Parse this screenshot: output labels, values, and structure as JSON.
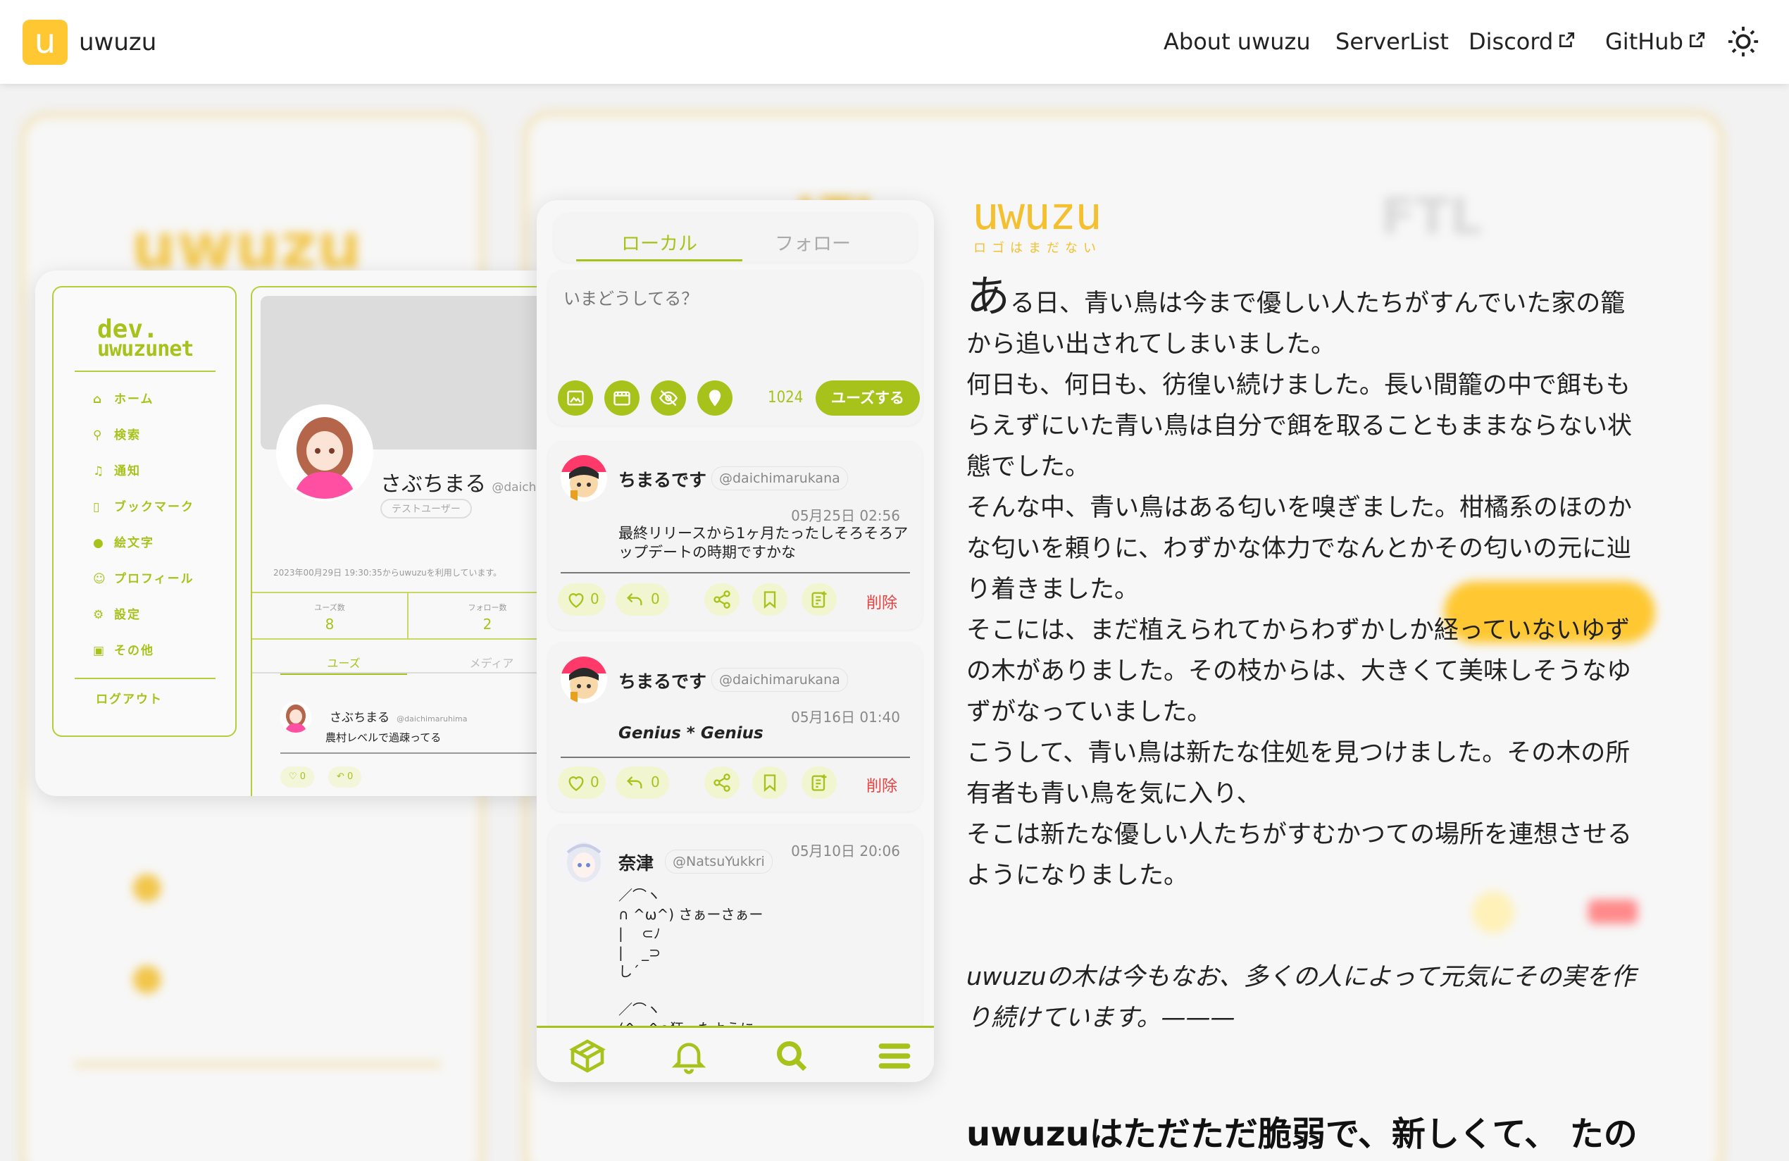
{
  "header": {
    "logo_letter": "u",
    "brand": "uwuzu",
    "nav": [
      "About uwuzu",
      "ServerList",
      "Discord",
      "GitHub"
    ],
    "theme_icon": "sun-icon"
  },
  "profile_mock": {
    "logo_line1": "dev.",
    "logo_line2": "uwuzunet",
    "menu": [
      {
        "icon": "home-icon",
        "label": "ホーム"
      },
      {
        "icon": "search-icon",
        "label": "検索"
      },
      {
        "icon": "bell-icon",
        "label": "通知"
      },
      {
        "icon": "bookmark-icon",
        "label": "ブックマーク"
      },
      {
        "icon": "pin-icon",
        "label": "絵文字"
      },
      {
        "icon": "profile-icon",
        "label": "プロフィール"
      },
      {
        "icon": "gear-icon",
        "label": "設定"
      },
      {
        "icon": "trash-icon",
        "label": "その他"
      }
    ],
    "logout": "ログアウト",
    "name": "さぶちまる",
    "handle": "@daichi",
    "badge": "テストユーザー",
    "joined": "2023年00月29日 19:30:35からuwuzuを利用しています。",
    "stats": [
      {
        "label": "ユーズ数",
        "value": "8"
      },
      {
        "label": "フォロー数",
        "value": "2"
      }
    ],
    "tabs": [
      "ユーズ",
      "メディア"
    ],
    "post": {
      "name": "さぶちまる",
      "handle": "@daichimaruhima",
      "text": "農村レベルで過疎ってる",
      "likes": "0",
      "reuse": "0"
    }
  },
  "timeline": {
    "tabs": [
      "ローカル",
      "フォロー"
    ],
    "active_tab": "ローカル",
    "compose": {
      "placeholder": "いまどうしてる？",
      "char_count": "1024",
      "submit": "ユーズする",
      "buttons": [
        "image-icon",
        "video-icon",
        "nsfw-eye-icon",
        "pin-icon"
      ]
    },
    "posts": [
      {
        "name": "ちまるです",
        "handle": "@daichimarukana",
        "time": "05月25日 02:56",
        "text": "最終リリースから1ヶ月たったしそろそろア\nップデートの時期ですかな",
        "likes": "0",
        "reuse": "0",
        "delete": "削除"
      },
      {
        "name": "ちまるです",
        "handle": "@daichimarukana",
        "time": "05月16日 01:40",
        "text": "Genius * Genius",
        "likes": "0",
        "reuse": "0",
        "delete": "削除"
      },
      {
        "name": "奈津",
        "handle": "@NatsuYukkri",
        "time": "05月10日 20:06",
        "text": "／⌒ヽ\n∩ ^ω^) さぁーさぁー\n|　 ⊂ﾉ\n| 　_⊃\nし´\n\n／⌒ヽ\n(^ω^∩狂ったように"
      }
    ],
    "bottom_nav": [
      "home-box-icon",
      "bell-icon",
      "search-icon",
      "menu-icon"
    ]
  },
  "story": {
    "logo": "uwuzu",
    "logo_sub": "ロゴはまだない",
    "first_char": "あ",
    "paragraph": "る日、青い鳥は今まで優しい人たちがすんでいた家の籠から追い出されてしまいました。\n何日も、何日も、彷徨い続けました。長い間籠の中で餌ももらえずにいた青い鳥は自分で餌を取ることもままならない状態でした。\nそんな中、青い鳥はある匂いを嗅ぎました。柑橘系のほのかな匂いを頼りに、わずかな体力でなんとかその匂いの元に辿り着きました。\nそこには、まだ植えられてからわずかしか経っていないゆずの木がありました。その枝からは、大きくて美味しそうなゆずがなっていました。\nこうして、青い鳥は新たな住処を見つけました。その木の所有者も青い鳥を気に入り、\nそこは新たな優しい人たちがすむかつての場所を連想させるようになりました。",
    "quote": "uwuzuの木は今もなお、多くの人によって元気にその実を作り続けています。———",
    "bottom": "uwuzuはただただ脆弱で、新しくて、 たの"
  },
  "colors": {
    "accent_green": "#a8c21c",
    "brand_yellow": "#ffc832",
    "delete_red": "#e84040"
  }
}
